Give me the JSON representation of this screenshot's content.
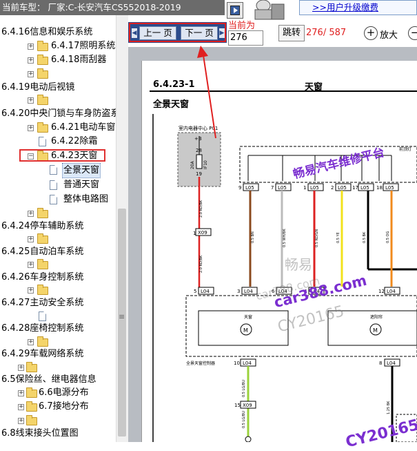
{
  "topbar": {
    "title": "当前车型： 厂家:C-长安汽车CS552018-2019",
    "upgrade_link": ">>用户升级缴费",
    "toggle_icon": "expand-icon",
    "mascot_icon": "mascot-icon"
  },
  "sidebar": {
    "items": [
      {
        "label": "6.4.16信息和娱乐系统"
      },
      {
        "label": "6.4.17照明系统"
      },
      {
        "label": "6.4.18雨刮器"
      },
      {
        "label": "6.4.19电动后视镜"
      },
      {
        "label": "6.4.20中央门锁与车身防盗系"
      },
      {
        "label": "6.4.21电动车窗"
      },
      {
        "label": "6.4.22除霜"
      },
      {
        "label": "6.4.23天窗"
      },
      {
        "label": "全景天窗"
      },
      {
        "label": "普通天窗"
      },
      {
        "label": "整体电路图"
      },
      {
        "label": "6.4.24停车辅助系统"
      },
      {
        "label": "6.4.25自动泊车系统"
      },
      {
        "label": "6.4.26车身控制系统"
      },
      {
        "label": "6.4.27主动安全系统"
      },
      {
        "label": "6.4.28座椅控制系统"
      },
      {
        "label": "6.4.29车载网络系统"
      },
      {
        "label": "6.5保险丝、继电器信息"
      },
      {
        "label": "6.6电源分布"
      },
      {
        "label": "6.7接地分布"
      },
      {
        "label": "6.8线束接头位置图"
      }
    ]
  },
  "nav": {
    "prev_label": "上一 页",
    "next_label": "下一 页",
    "current_label": "当前为",
    "page_value": "276",
    "jump_label": "跳转",
    "page_count": "276/ 587",
    "zoom_in_label": "放大",
    "zoom_in_icon": "zoom-in-icon",
    "zoom_out_icon": "zoom-out-icon"
  },
  "document": {
    "code": "6.4.23-1",
    "title": "天窗",
    "subtitle": "全景天窗",
    "labels": {
      "p01": "室内电器中心 P01",
      "pb": "+B",
      "pin28": "28",
      "pin19": "19",
      "fuse": "20A",
      "fuse_id": "IF10",
      "right_top": "前顶灯",
      "x09": "X09",
      "l05": "L05",
      "l04": "L04",
      "motor1": "天窗",
      "motor2": "遮阳帘",
      "controller": "全景天窗控制器",
      "pin9": "9",
      "pin7": "7",
      "pin1": "1",
      "pin2": "2",
      "pin17": "17",
      "pin18": "18",
      "pin5": "5",
      "pin3": "3",
      "pin6": "6",
      "pin4": "4",
      "pin8": "8",
      "pin10": "10",
      "pin15": "15",
      "pin12": "12",
      "pin1b": "1",
      "m": "M",
      "w1": "2.0 RD/BK",
      "w2": "0.5 BN",
      "w3": "0.5 WH/BK",
      "w4": "0.5 RD/GN",
      "w5": "0.5 YE",
      "w6": "0.5 BK",
      "w7": "0.5 OG",
      "w8": "0.5 LG/BU",
      "w9": "1.25 BK"
    }
  },
  "watermarks": {
    "w1": "畅易汽车维修平台",
    "w2": "畅易",
    "w3": "car388.com",
    "w4": "CY20165",
    "w5": "car388.com",
    "w6": "CY2016543"
  },
  "colors": {
    "topbar_bg": "#6b6b6b",
    "nav_bg": "#2c4c8c",
    "highlight_red": "#e02020",
    "link_blue": "#0000cc",
    "watermark_purple": "#7b2fd0"
  }
}
